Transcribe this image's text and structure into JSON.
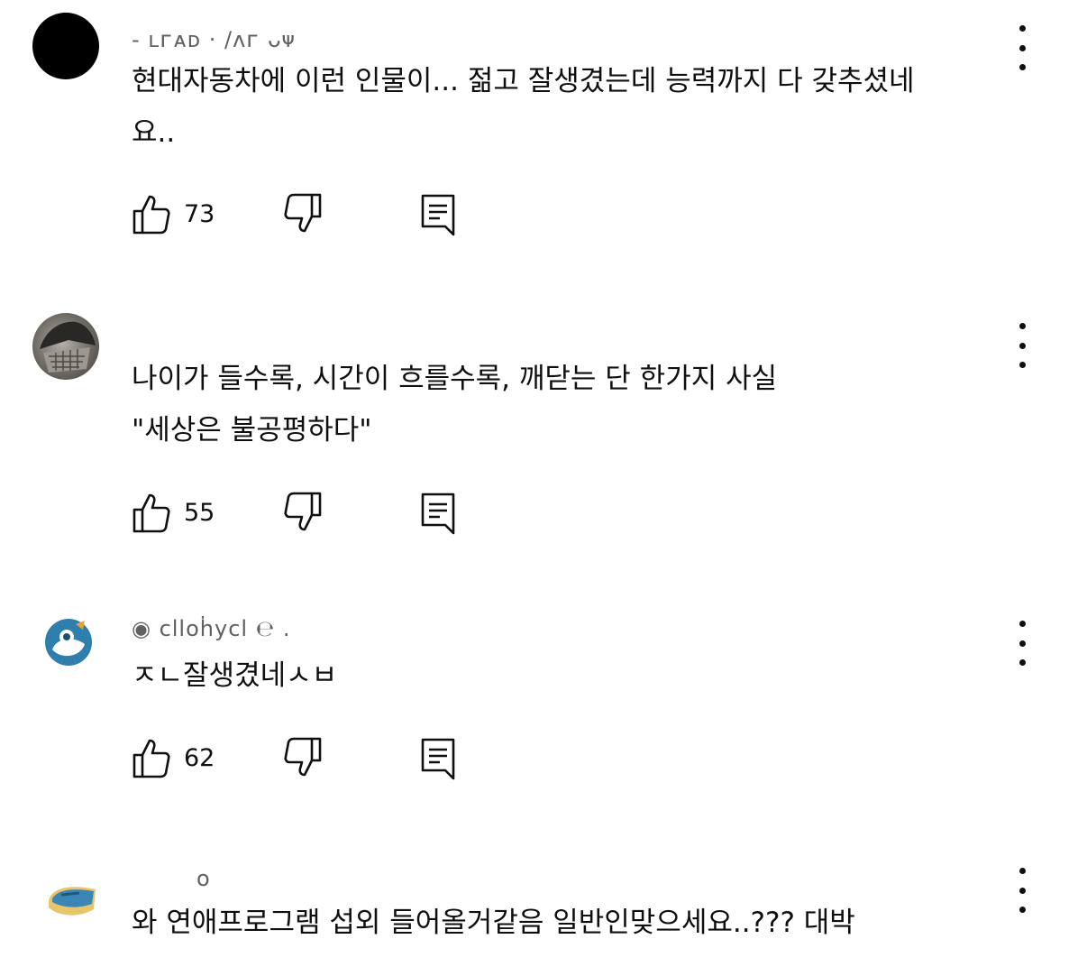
{
  "comments": [
    {
      "author": "- ʟᴦᴀᴅ ·    /ᴧᴦ ᴗᴪ",
      "text": "현대자동차에 이런 인물이... 젊고 잘생겼는데 능력까지 다 갖추셨네\n요..",
      "likes": "73",
      "avatar_color": "#000000"
    },
    {
      "author": "",
      "text": "나이가 들수록, 시간이 흐를수록, 깨닫는 단 한가지 사실\n\"세상은 불공평하다\"",
      "likes": "55",
      "avatar_color": "#8a8a86"
    },
    {
      "author": "◉ clloḣycl   ℮ .",
      "text": "ㅈㄴ잘생겼네ㅅㅂ",
      "likes": "62",
      "avatar_color": "#4a8fb8"
    },
    {
      "author": "o",
      "text": "와 연애프로그램 섭외 들어올거같음 일반인맞으세요..??? 대박",
      "likes": "",
      "avatar_color": "#3b86b5"
    }
  ]
}
